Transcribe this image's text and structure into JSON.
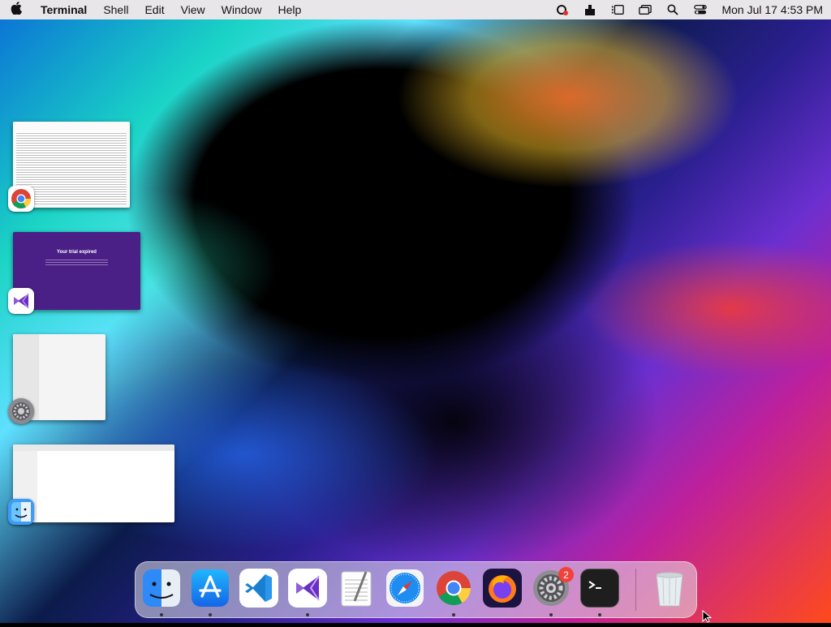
{
  "menubar": {
    "app_name": "Terminal",
    "menus": [
      "Shell",
      "Edit",
      "View",
      "Window",
      "Help"
    ],
    "clock": "Mon Jul 17  4:53 PM",
    "status_icons": [
      "creative-cloud-icon",
      "accessibility-icon",
      "stage-manager-icon",
      "window-switch-icon",
      "spotlight-search-icon",
      "control-center-icon"
    ]
  },
  "windows": [
    {
      "app": "Google Chrome",
      "icon": "chrome-icon"
    },
    {
      "app": "Visual Studio",
      "icon": "visual-studio-icon",
      "heading": "Your trial expired"
    },
    {
      "app": "System Settings",
      "icon": "system-settings-icon"
    },
    {
      "app": "Finder",
      "icon": "finder-icon"
    }
  ],
  "dock": {
    "items": [
      {
        "name": "Finder",
        "running": true
      },
      {
        "name": "App Store",
        "running": true
      },
      {
        "name": "Visual Studio Code",
        "running": false
      },
      {
        "name": "Visual Studio",
        "running": true
      },
      {
        "name": "TextEdit",
        "running": false
      },
      {
        "name": "Safari",
        "running": false
      },
      {
        "name": "Google Chrome",
        "running": true
      },
      {
        "name": "Firefox",
        "running": false
      },
      {
        "name": "System Settings",
        "running": true,
        "badge": "2"
      },
      {
        "name": "Terminal",
        "running": true
      },
      {
        "name": "Trash",
        "running": false
      }
    ]
  },
  "colors": {
    "menubar_bg": "#e8e6e8",
    "badge_red": "#f0413a",
    "vs_purple": "#4a1f86"
  }
}
